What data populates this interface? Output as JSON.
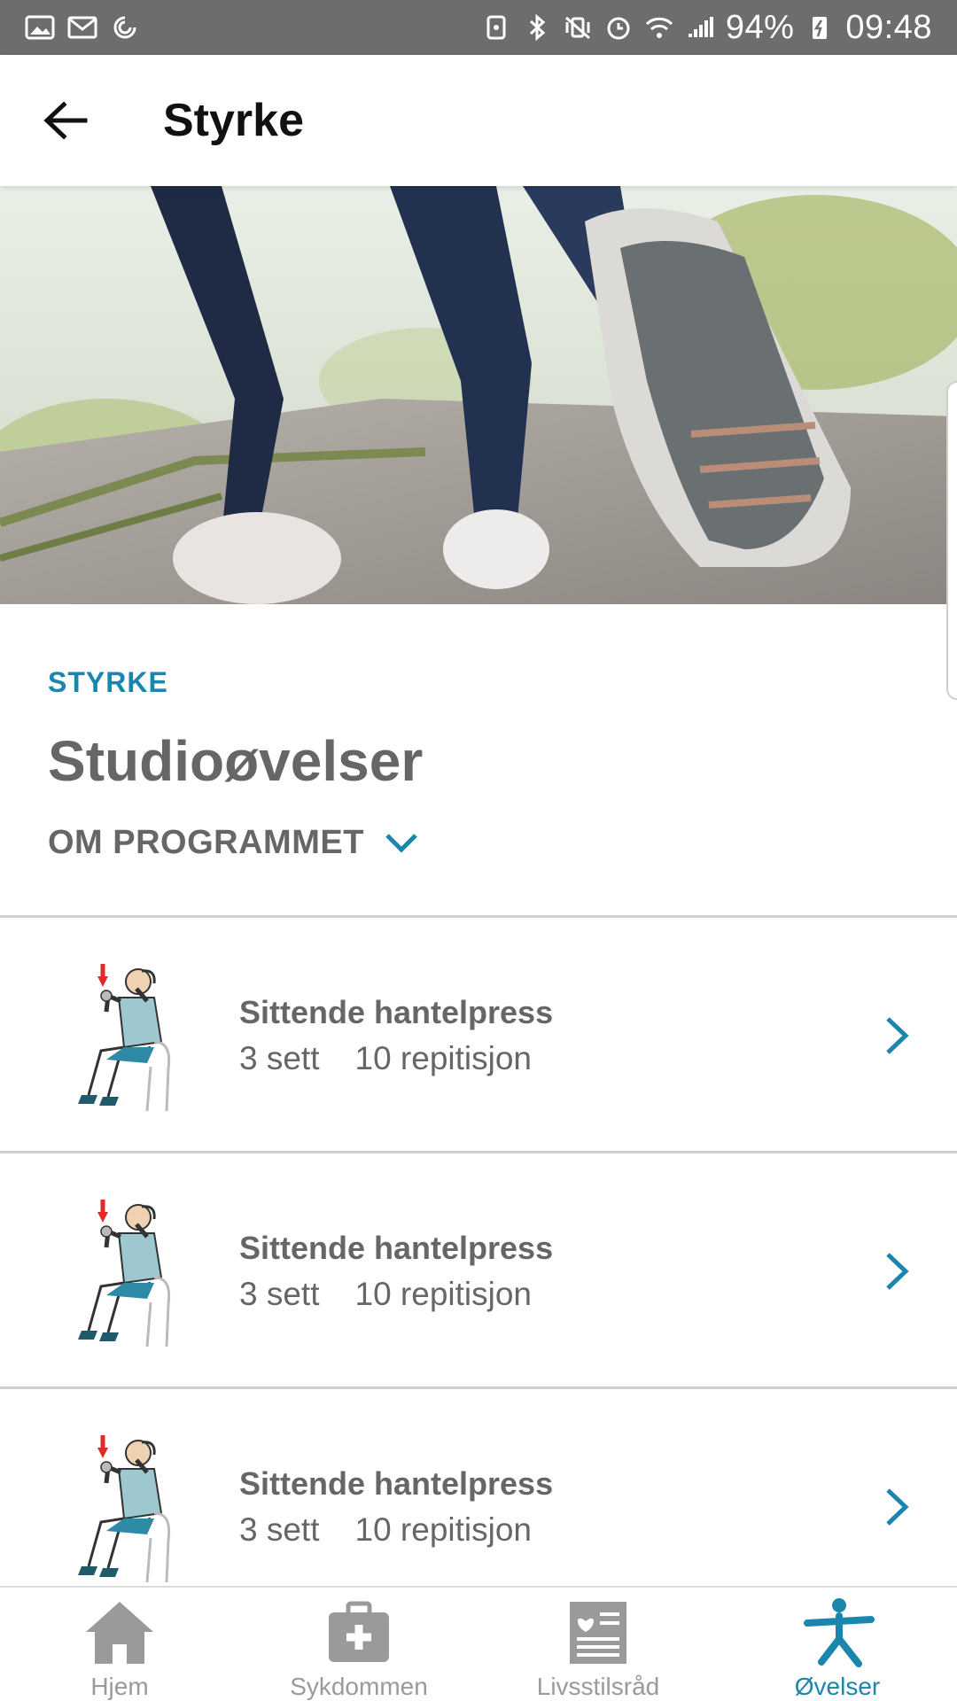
{
  "status_bar": {
    "battery": "94%",
    "time": "09:48"
  },
  "app_bar": {
    "title": "Styrke"
  },
  "program": {
    "kicker": "STYRKE",
    "title": "Studioøvelser",
    "about_label": "OM PROGRAMMET"
  },
  "exercises": [
    {
      "name": "Sittende hantelpress",
      "sets": "3 sett",
      "reps": "10 repitisjon"
    },
    {
      "name": "Sittende hantelpress",
      "sets": "3 sett",
      "reps": "10 repitisjon"
    },
    {
      "name": "Sittende hantelpress",
      "sets": "3 sett",
      "reps": "10 repitisjon"
    }
  ],
  "bottom_nav": [
    {
      "label": "Hjem",
      "icon": "home-icon",
      "active": false
    },
    {
      "label": "Sykdommen",
      "icon": "medical-kit-icon",
      "active": false
    },
    {
      "label": "Livsstilsråd",
      "icon": "news-heart-icon",
      "active": false
    },
    {
      "label": "Øvelser",
      "icon": "exercise-person-icon",
      "active": true
    }
  ],
  "colors": {
    "accent": "#1b86ad",
    "status_bar": "#6d6d6d",
    "muted_text": "#666666",
    "nav_inactive": "#9a9a9a"
  }
}
